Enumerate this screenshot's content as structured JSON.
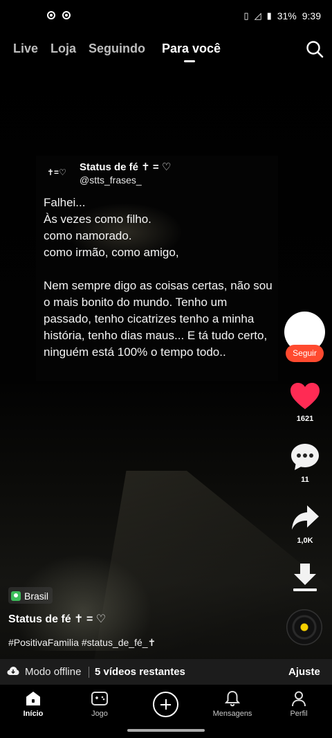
{
  "status_bar": {
    "battery": "31%",
    "time": "9:39"
  },
  "top_nav": {
    "tabs": [
      {
        "label": "Live"
      },
      {
        "label": "Loja"
      },
      {
        "label": "Seguindo"
      },
      {
        "label": "Para você"
      }
    ],
    "active_tab": "Para você"
  },
  "card": {
    "avatar_text": "✝︎=♡",
    "name": "Status de fé ✝︎ = ♡",
    "handle": "@stts_frases_",
    "body": "Falhei...\nÀs vezes como filho.\ncomo namorado.\ncomo irmão, como amigo,\n\nNem sempre digo as coisas certas, não sou o mais bonito do mundo. Tenho um passado, tenho cicatrizes tenho a minha história, tenho dias maus... E tá tudo certo, ninguém está 100% o tempo todo.."
  },
  "actions": {
    "follow_label": "Seguir",
    "likes": "1621",
    "comments": "11",
    "shares": "1,0K"
  },
  "caption": {
    "location": "Brasil",
    "author": "Status de fé ✝︎ = ♡",
    "hashtags": "#PositivaFamilia #status_de_fé_✝︎"
  },
  "offline_bar": {
    "label": "Modo offline",
    "remaining": "5 vídeos restantes",
    "adjust": "Ajuste"
  },
  "bottom_nav": {
    "home": "Início",
    "game": "Jogo",
    "messages": "Mensagens",
    "profile": "Perfil"
  },
  "colors": {
    "like": "#ff2b54",
    "follow": "#ff4a2f",
    "location_pin": "#3cbe5a"
  }
}
